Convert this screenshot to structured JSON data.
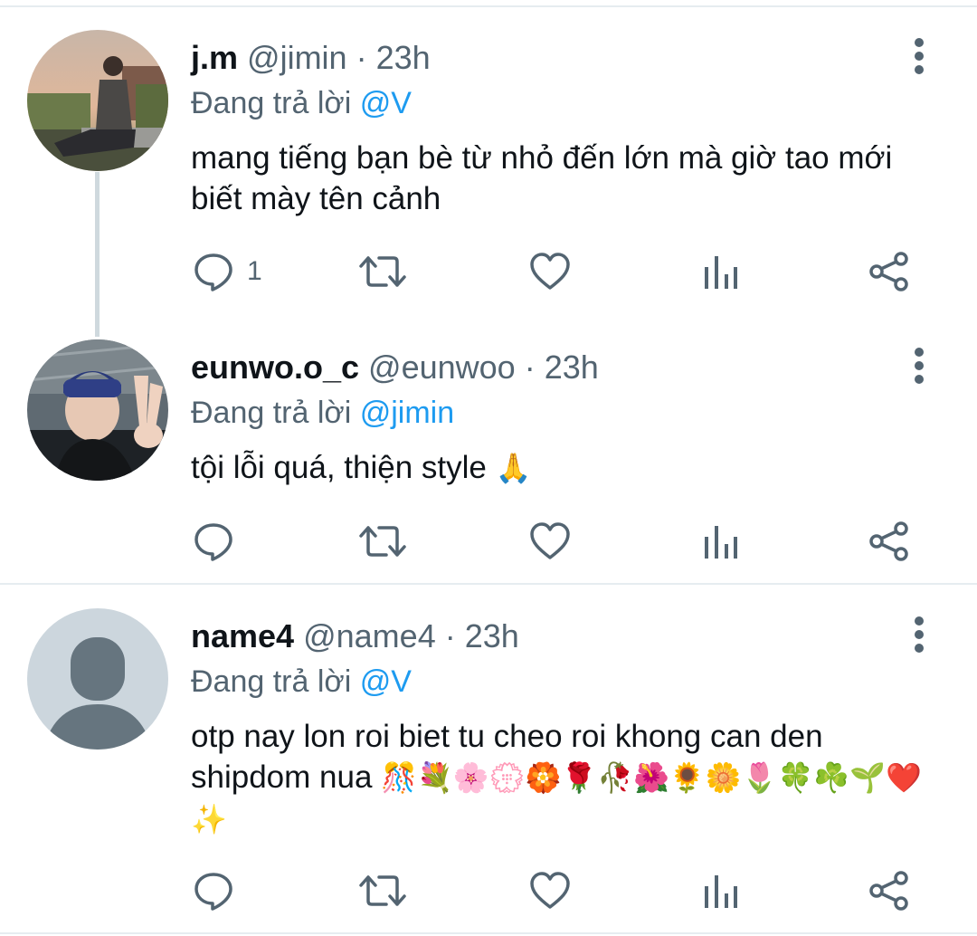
{
  "tweets": [
    {
      "name": "j.m",
      "handle": "@jimin",
      "sep": "·",
      "time": "23h",
      "reply_prefix": "Đang trả lời",
      "reply_to": "@V",
      "text": "mang tiếng bạn bè từ nhỏ đến lớn mà giờ tao mới biết mày tên cảnh",
      "reply_count": "1",
      "avatar": "photo-person-sitting-outdoors"
    },
    {
      "name": "eunwo.o_c",
      "handle": "@eunwoo",
      "sep": "·",
      "time": "23h",
      "reply_prefix": "Đang trả lời",
      "reply_to": "@jimin",
      "text": "tội lỗi quá, thiện style",
      "emoji": "🙏",
      "reply_count": "",
      "avatar": "photo-person-peace-sign"
    },
    {
      "name": "name4",
      "handle": "@name4",
      "sep": "·",
      "time": "23h",
      "reply_prefix": "Đang trả lời",
      "reply_to": "@V",
      "text": "otp nay lon roi biet tu cheo roi khong can den shipdom nua",
      "emoji": "🎊💐🌸💮🏵️🌹🥀🌺🌻🌼🌷🍀☘️🌱❤️✨",
      "reply_count": "",
      "avatar": "default-avatar-placeholder"
    }
  ],
  "icons": {
    "reply": "reply-icon",
    "retweet": "retweet-icon",
    "like": "heart-icon",
    "analytics": "analytics-icon",
    "share": "share-icon",
    "more": "more-vertical-icon"
  },
  "colors": {
    "link": "#1d9bf0",
    "secondary": "#536471",
    "text": "#0f1419",
    "divider": "#e6ecf0",
    "thread_line": "#cfd9de",
    "placeholder_bg": "#ccd6dd",
    "placeholder_fg": "#66757f"
  }
}
